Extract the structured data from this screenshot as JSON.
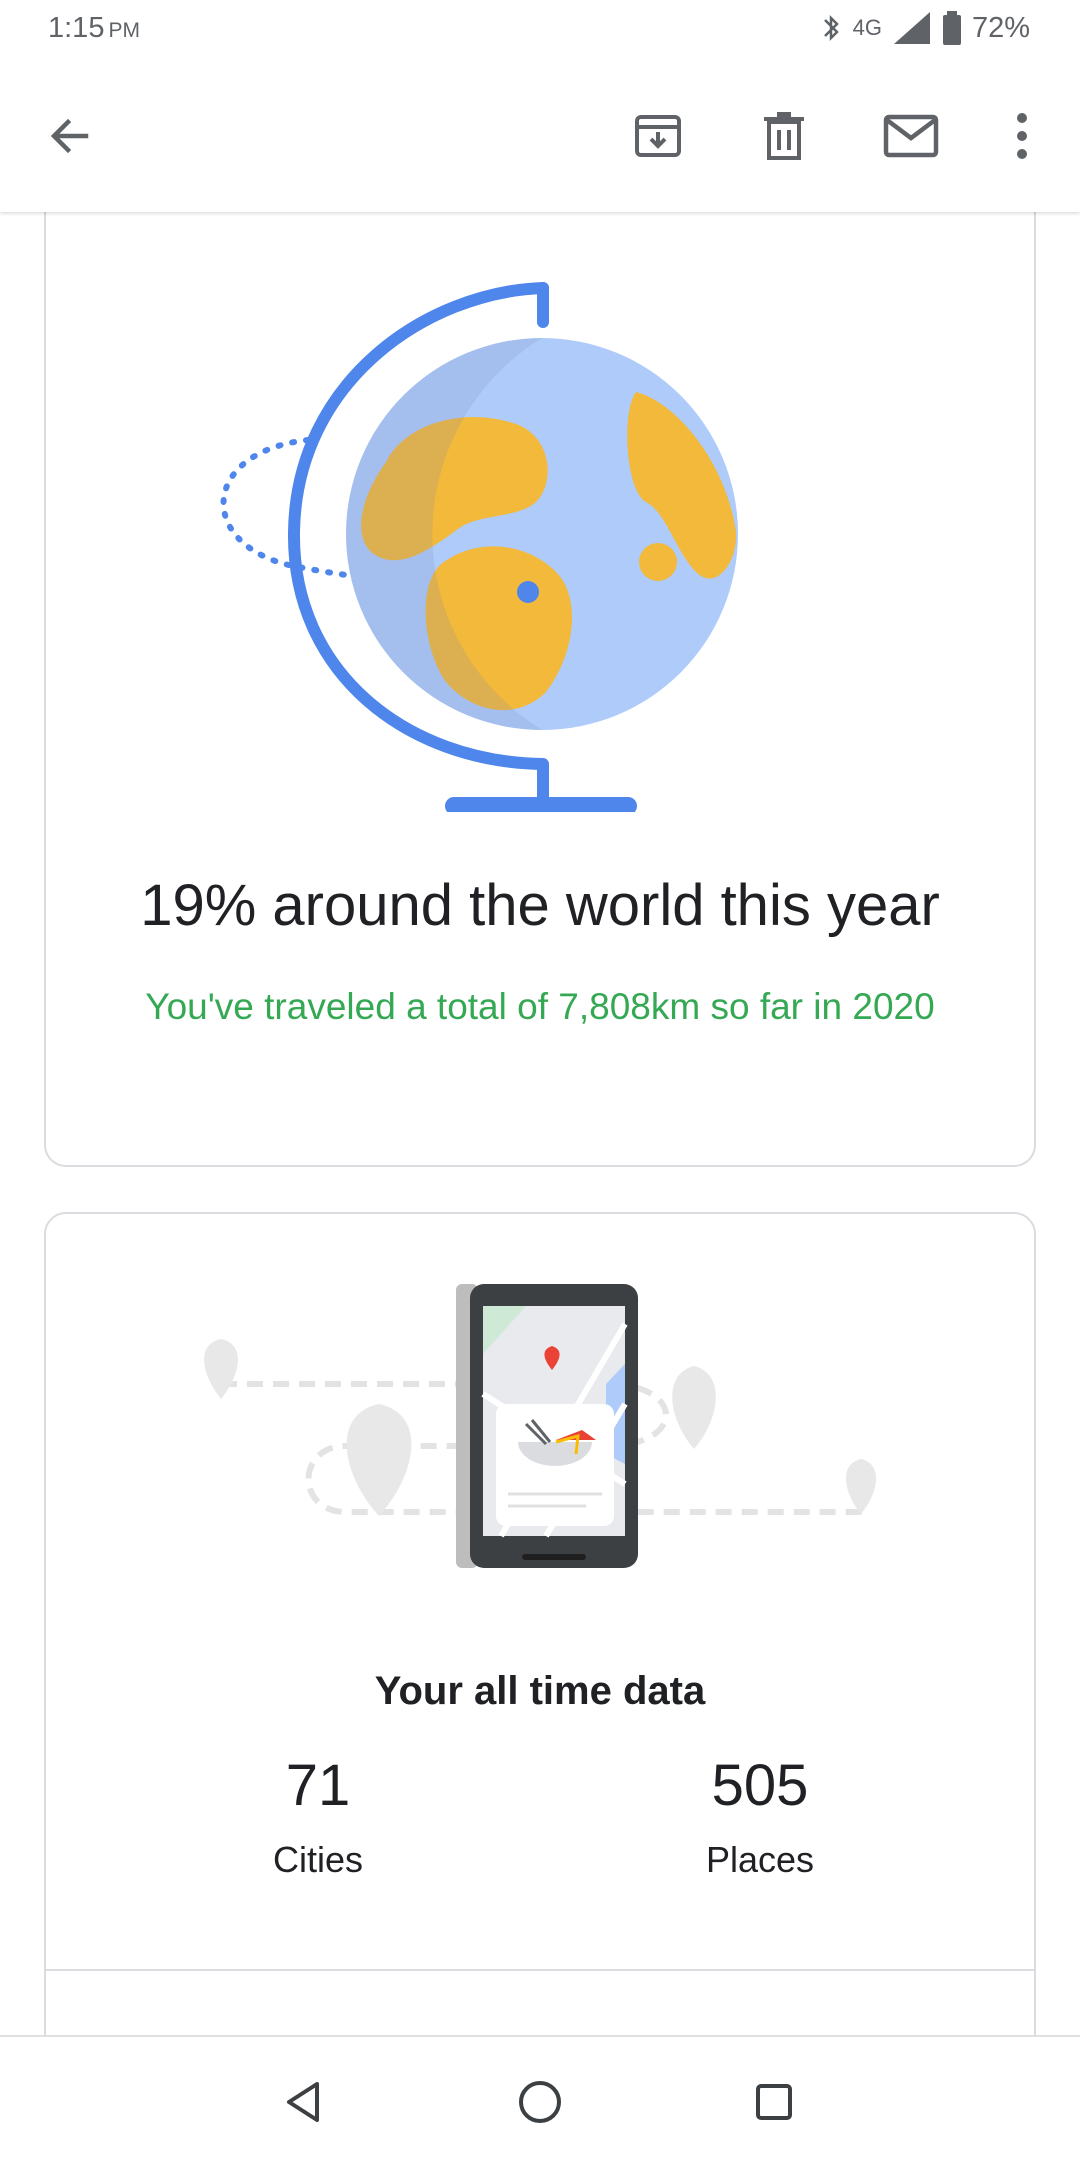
{
  "status_bar": {
    "time": "1:15",
    "ampm": "PM",
    "network": "4G",
    "battery": "72%"
  },
  "toolbar": {
    "icons": [
      "back-arrow-icon",
      "archive-icon",
      "delete-icon",
      "mail-icon",
      "more-vert-icon"
    ]
  },
  "world_card": {
    "title": "19% around the world this year",
    "subtitle": "You've traveled a total of 7,808km so far in 2020",
    "progress_fraction": 0.19
  },
  "data_card": {
    "title": "Your all time data",
    "stats": [
      {
        "value": "71",
        "label": "Cities"
      },
      {
        "value": "505",
        "label": "Places"
      }
    ]
  },
  "colors": {
    "accent_green": "#34a853",
    "globe_blue": "#4f86ec",
    "globe_light": "#aecbfa",
    "land_yellow": "#f2b93b"
  }
}
